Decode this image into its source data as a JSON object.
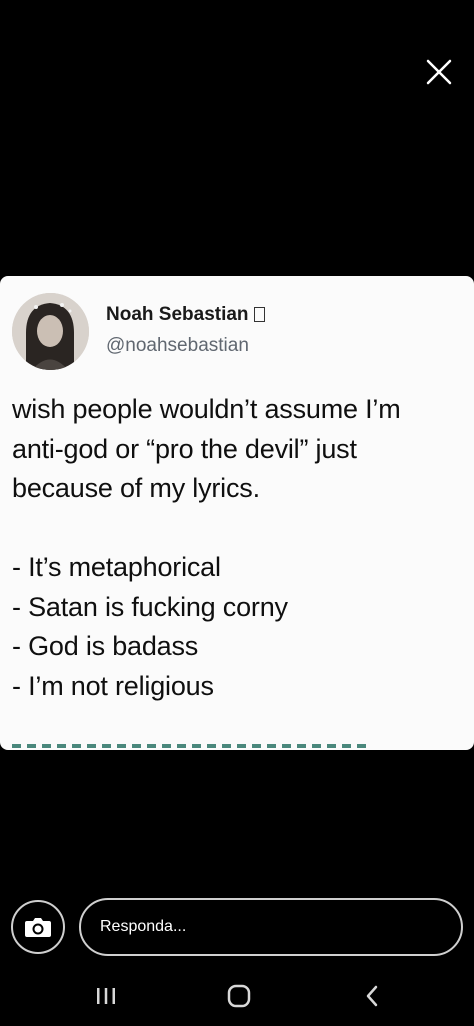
{
  "viewer": {
    "close_icon": "close-icon"
  },
  "tweet": {
    "display_name": "Noah Sebastian",
    "handle": "@noahsebastian",
    "lines": [
      "wish people wouldn’t assume I’m",
      "anti-god or “pro the devil” just",
      "because of my lyrics.",
      "",
      "- It’s metaphorical",
      "- Satan is fucking corny",
      "- God is badass",
      "- I’m not religious"
    ]
  },
  "reply": {
    "placeholder": "Responda...",
    "camera_icon": "camera-icon"
  },
  "navigation": {
    "recents_icon": "recent-apps-icon",
    "home_icon": "home-icon",
    "back_icon": "back-icon"
  },
  "colors": {
    "background": "#000000",
    "card": "#fbfbfb",
    "text": "#0f0f0f",
    "handle": "#606770"
  }
}
